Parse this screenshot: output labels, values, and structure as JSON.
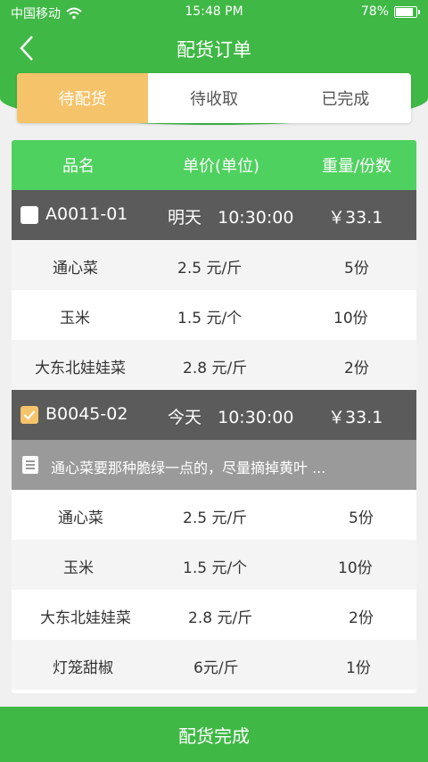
{
  "status_bar": {
    "carrier": "中国移动",
    "time": "15:48 PM",
    "battery": "78%"
  },
  "nav": {
    "title": "配货订单"
  },
  "tabs": [
    {
      "label": "待配货",
      "active": true
    },
    {
      "label": "待收取",
      "active": false
    },
    {
      "label": "已完成",
      "active": false
    }
  ],
  "table": {
    "headers": [
      "品名",
      "单价(单位)",
      "重量/份数"
    ]
  },
  "orders": [
    {
      "code": "A0011-01",
      "when": "明天   10:30:00",
      "price": "￥33.1",
      "checked": false,
      "items": [
        {
          "name": "通心菜",
          "price": "2.5 元/斤",
          "qty": "5份"
        },
        {
          "name": "玉米",
          "price": "1.5 元/个",
          "qty": "10份"
        },
        {
          "name": "大东北娃娃菜",
          "price": "2.8 元/斤",
          "qty": "2份"
        }
      ]
    },
    {
      "code": "B0045-02",
      "when": "今天   10:30:00",
      "price": "￥33.1",
      "checked": true,
      "note": "通心菜要那种脆绿一点的，尽量摘掉黄叶 ...",
      "items": [
        {
          "name": "通心菜",
          "price": "2.5 元/斤",
          "qty": "5份"
        },
        {
          "name": "玉米",
          "price": "1.5 元/个",
          "qty": "10份"
        },
        {
          "name": "大东北娃娃菜",
          "price": "2.8 元/斤",
          "qty": "2份"
        },
        {
          "name": "灯笼甜椒",
          "price": "6元/斤",
          "qty": "1份"
        }
      ]
    }
  ],
  "footer": {
    "button_label": "配货完成"
  },
  "colors": {
    "green": "#3fb845",
    "header_green": "#4fd15f",
    "orange": "#f5c36a",
    "order_row": "#5b5b5b",
    "note_row": "#9a9a9a"
  }
}
